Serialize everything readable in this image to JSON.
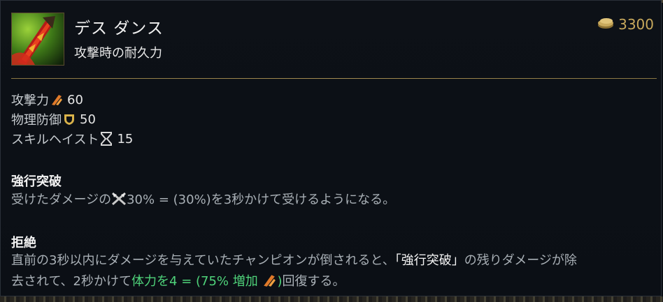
{
  "item": {
    "name": "デス ダンス",
    "subtitle": "攻撃時の耐久力",
    "price": "3300",
    "icons": {
      "item": "death-dance-blade-icon",
      "gold": "gold-coin-icon"
    }
  },
  "stats": [
    {
      "label": "攻撃力",
      "icon": "attack-damage-icon",
      "value": "60"
    },
    {
      "label": "物理防御",
      "icon": "armor-shield-icon",
      "value": "50"
    },
    {
      "label": "スキルヘイスト",
      "icon": "hourglass-icon",
      "value": "15"
    }
  ],
  "passive1": {
    "title": "強行突破",
    "text_pre": "受けたダメージの",
    "icon": "crossed-swords-icon",
    "text_post": "30% = (30%)を3秒かけて受けるようになる。"
  },
  "passive2": {
    "title": "拒絶",
    "line1_pre": "直前の3秒以内にダメージを与えていたチャンピオンが倒されると、",
    "line1_highlight": "「強行突破」",
    "line1_post": "の残りダメージが除",
    "line2_pre": "去されて、2秒かけて",
    "line2_heal": "体力を4 = (75% 増加 ",
    "heal_icon": "attack-damage-icon",
    "line2_close": ")",
    "line2_post": "回復する。"
  },
  "colors": {
    "gold": "#c8a95c",
    "heal": "#4fd37a",
    "divider": "#a48c52",
    "background": "#0b0f15"
  }
}
